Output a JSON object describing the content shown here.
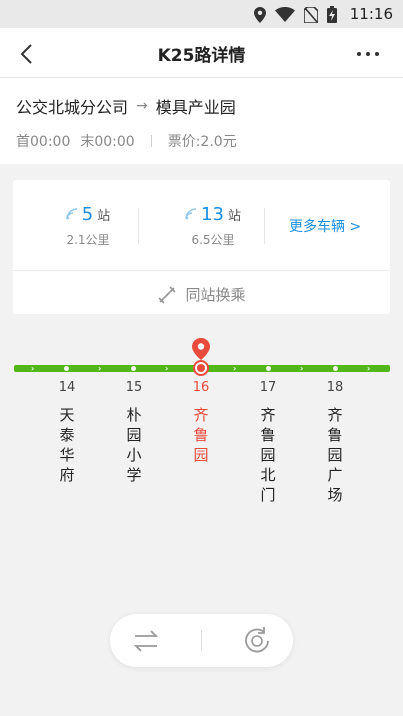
{
  "status_bar": {
    "time": "11:16",
    "icons": [
      "location-icon",
      "wifi-icon",
      "no-sim-icon",
      "battery-charging-icon"
    ]
  },
  "nav": {
    "title": "K25路详情",
    "back_icon": "back-arrow-icon",
    "more_icon": "more-dots-icon"
  },
  "route": {
    "origin": "公交北城分公司",
    "arrow": "→",
    "destination": "模具产业园",
    "first_bus": "首00:00",
    "last_bus": "末00:00",
    "fare": "票价:2.0元"
  },
  "buses": [
    {
      "stops": "5",
      "unit": "站",
      "distance": "2.1公里"
    },
    {
      "stops": "13",
      "unit": "站",
      "distance": "6.5公里"
    }
  ],
  "more_buses": "更多车辆 >",
  "transfer": {
    "label": "同站换乘",
    "icon": "transfer-icon"
  },
  "stops": [
    {
      "num": "14",
      "name": "天泰华府"
    },
    {
      "num": "15",
      "name": "朴园小学"
    },
    {
      "num": "16",
      "name": "齐鲁园",
      "current": true
    },
    {
      "num": "17",
      "name": "齐鲁园北门"
    },
    {
      "num": "18",
      "name": "齐鲁园广场"
    }
  ],
  "colors": {
    "accent": "#1a8fe0",
    "line": "#52b81a",
    "current": "#e84b3c"
  },
  "actions": {
    "swap_icon": "swap-direction-icon",
    "refresh_icon": "refresh-icon"
  }
}
